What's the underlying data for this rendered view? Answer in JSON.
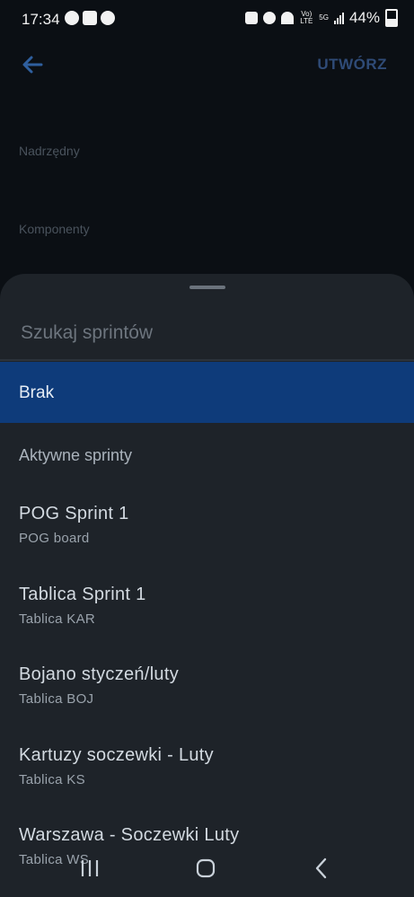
{
  "status_bar": {
    "time": "17:34",
    "battery": "44%",
    "network_top": "5G",
    "volte": "Vo) LTE"
  },
  "header": {
    "back_icon": "arrow-left-icon",
    "create_label": "UTWÓRZ"
  },
  "form": {
    "parent_label": "Nadrzędny",
    "components_label": "Komponenty"
  },
  "sheet": {
    "search_placeholder": "Szukaj sprintów",
    "none_option": "Brak",
    "section_header": "Aktywne sprinty",
    "sprints": [
      {
        "name": "POG Sprint 1",
        "board": "POG board"
      },
      {
        "name": "Tablica Sprint 1",
        "board": "Tablica KAR"
      },
      {
        "name": "Bojano styczeń/luty",
        "board": "Tablica BOJ"
      },
      {
        "name": "Kartuzy soczewki - Luty",
        "board": "Tablica KS"
      },
      {
        "name": "Warszawa - Soczewki Luty",
        "board": "Tablica WS"
      }
    ]
  },
  "colors": {
    "accent": "#2f4b77",
    "selected_bg": "#0e3b7a",
    "sheet_bg": "#1e2329",
    "page_bg": "#0b0f14"
  }
}
